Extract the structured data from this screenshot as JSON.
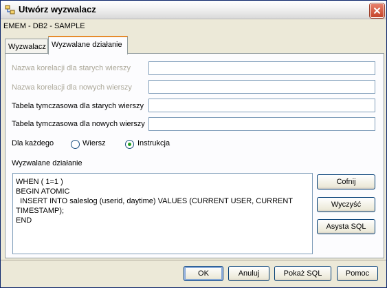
{
  "window": {
    "title": "Utwórz wyzwalacz",
    "subtitle": "EMEM - DB2 - SAMPLE"
  },
  "tabs": [
    {
      "label": "Wyzwalacz",
      "active": false
    },
    {
      "label": "Wyzwalane działanie",
      "active": true
    }
  ],
  "form": {
    "old_rows_correlation": {
      "label": "Nazwa korelacji dla starych wierszy",
      "value": "",
      "enabled": false
    },
    "new_rows_correlation": {
      "label": "Nazwa korelacji dla nowych wierszy",
      "value": "",
      "enabled": false
    },
    "old_rows_temp_table": {
      "label": "Tabela tymczasowa dla starych wierszy",
      "value": ""
    },
    "new_rows_temp_table": {
      "label": "Tabela tymczasowa dla nowych wierszy",
      "value": ""
    },
    "for_each": {
      "label": "Dla każdego",
      "options": [
        {
          "label": "Wiersz",
          "selected": false
        },
        {
          "label": "Instrukcja",
          "selected": true
        }
      ]
    },
    "action": {
      "label": "Wyzwalane działanie",
      "text": "WHEN ( 1=1 )\nBEGIN ATOMIC\n  INSERT INTO saleslog (userid, daytime) VALUES (CURRENT USER, CURRENT\nTIMESTAMP);\nEND"
    }
  },
  "side_buttons": {
    "undo": "Cofnij",
    "clear": "Wyczyść",
    "sql_assist": "Asysta SQL"
  },
  "bottom_buttons": {
    "ok": "OK",
    "cancel": "Anuluj",
    "show_sql": "Pokaż SQL",
    "help": "Pomoc"
  },
  "icons": {
    "app": "trigger-icon",
    "close": "close-icon"
  },
  "colors": {
    "tab_highlight": "#e68b2c",
    "close_button": "#c5442a",
    "radio_selected": "#21a121"
  }
}
